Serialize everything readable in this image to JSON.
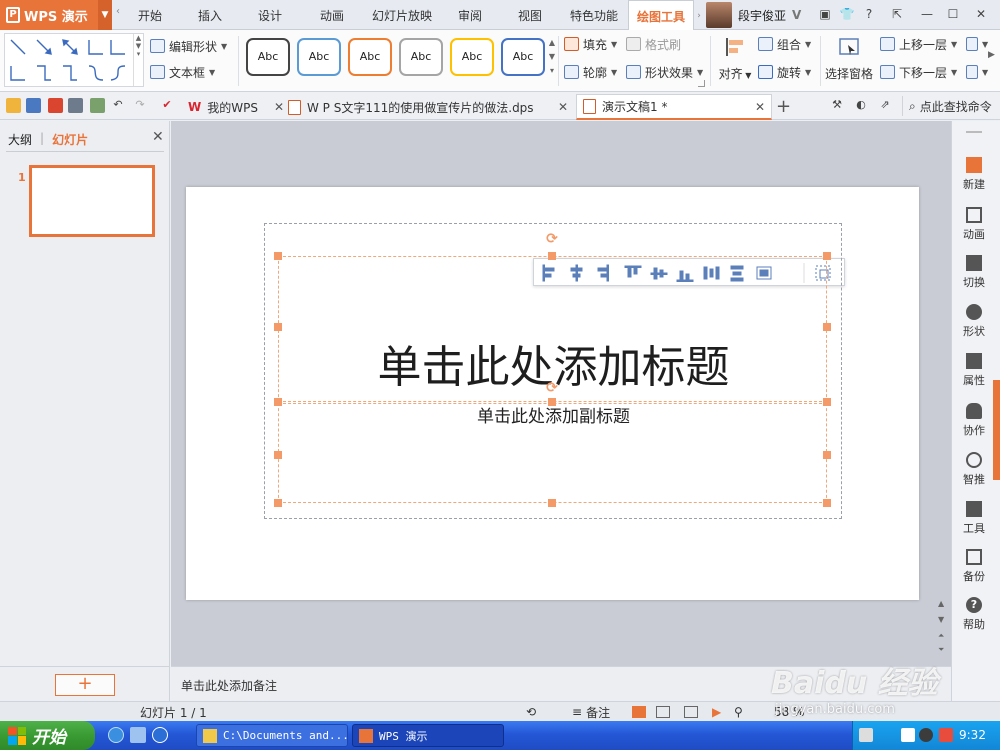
{
  "app": {
    "name": "WPS 演示",
    "logo_letter": "P"
  },
  "menu_tabs": [
    "开始",
    "插入",
    "设计",
    "动画",
    "幻灯片放映",
    "审阅",
    "视图",
    "特色功能",
    "绘图工具"
  ],
  "active_menu_tab": "绘图工具",
  "user": {
    "name": "段宇俊亚",
    "badge": "V"
  },
  "window_controls": {
    "help": "?",
    "minimize": "—",
    "restore": "☐",
    "close": "✕"
  },
  "ribbon": {
    "edit_shape": "编辑形状",
    "text_box": "文本框",
    "style_preview_label": "Abc",
    "style_colors": [
      "#444444",
      "#5b9bd5",
      "#ed7d31",
      "#a5a5a5",
      "#ffc000",
      "#4472c4"
    ],
    "fill": "填充",
    "format_painter": "格式刷",
    "outline": "轮廓",
    "shape_effects": "形状效果",
    "align": "对齐",
    "group": "组合",
    "rotate": "旋转",
    "selection_pane": "选择窗格",
    "bring_forward": "上移一层",
    "send_backward": "下移一层"
  },
  "doc_tabs": [
    {
      "label": "我的WPS",
      "active": false
    },
    {
      "label": "W P S文字111的使用做宣传片的做法.dps",
      "active": false
    },
    {
      "label": "演示文稿1 *",
      "active": true
    }
  ],
  "find_command": "点此查找命令",
  "left_panel": {
    "tab_outline": "大纲",
    "tab_slides": "幻灯片",
    "slide_number": "1",
    "add_slide": "+"
  },
  "slide": {
    "title_placeholder": "单击此处添加标题",
    "subtitle_placeholder": "单击此处添加副标题"
  },
  "right_sidebar": [
    "新建",
    "动画",
    "切换",
    "形状",
    "属性",
    "协作",
    "智推",
    "工具",
    "备份",
    "帮助"
  ],
  "notes_placeholder": "单击此处添加备注",
  "status": {
    "slide_count": "幻灯片 1 / 1",
    "notes": "备注",
    "zoom": "58 %"
  },
  "taskbar": {
    "start": "开始",
    "tasks": [
      "C:\\Documents and...",
      "WPS 演示"
    ],
    "clock": "9:32"
  },
  "watermark": {
    "logo": "Baidu 经验",
    "url": "jingyan.baidu.com"
  }
}
